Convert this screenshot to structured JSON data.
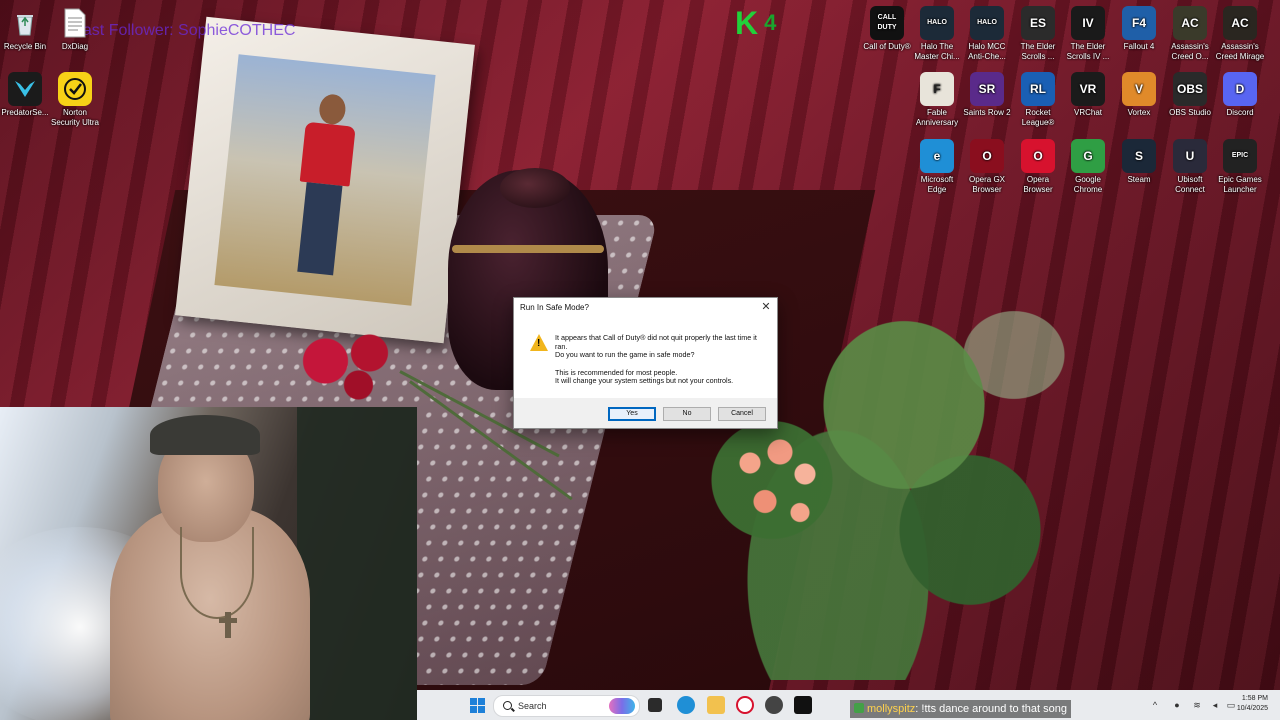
{
  "overlay": {
    "title_text": "Last Follower: SophieCOTHEC",
    "k_letter": "K",
    "k_count": "4"
  },
  "desktop_icons_left": [
    {
      "label": "Recycle Bin",
      "icon": "recycle-bin-icon"
    },
    {
      "label": "DxDiag",
      "icon": "dxdiag-icon"
    },
    {
      "label": "PredatorSe...",
      "icon": "predator-sense-icon"
    },
    {
      "label": "Norton Security Ultra",
      "icon": "norton-icon"
    }
  ],
  "desktop_icons_right": [
    {
      "label": "Call of Duty®",
      "icon": "call-of-duty-icon",
      "color": "#111111",
      "glyph": "CALL DUTY"
    },
    {
      "label": "Halo The Master Chi...",
      "icon": "halo-mcc-icon",
      "color": "#1c2a38",
      "glyph": "HALO"
    },
    {
      "label": "Halo MCC Anti-Che...",
      "icon": "halo-anticheat-icon",
      "color": "#1c2a38",
      "glyph": "HALO"
    },
    {
      "label": "The Elder Scrolls ...",
      "icon": "elder-scrolls-icon",
      "color": "#2b2b2b",
      "glyph": "ES"
    },
    {
      "label": "The Elder Scrolls IV ...",
      "icon": "oblivion-icon",
      "color": "#1a1a1a",
      "glyph": "IV"
    },
    {
      "label": "Fallout 4",
      "icon": "fallout4-icon",
      "color": "#1f5fa8",
      "glyph": "F4"
    },
    {
      "label": "Assassin's Creed O...",
      "icon": "ac-origins-icon",
      "color": "#3a3a2a",
      "glyph": "AC"
    },
    {
      "label": "Assassin's Creed Mirage",
      "icon": "ac-mirage-icon",
      "color": "#2a2620",
      "glyph": "AC"
    },
    {
      "label": "Fable Anniversary",
      "icon": "fable-icon",
      "color": "#e8e4da",
      "glyph": "F"
    },
    {
      "label": "Saints Row 2",
      "icon": "saints-row-icon",
      "color": "#5a2a8a",
      "glyph": "SR"
    },
    {
      "label": "Rocket League®",
      "icon": "rocket-league-icon",
      "color": "#1a5fb4",
      "glyph": "RL"
    },
    {
      "label": "VRChat",
      "icon": "vrchat-icon",
      "color": "#1b1b1b",
      "glyph": "VR"
    },
    {
      "label": "Vortex",
      "icon": "vortex-icon",
      "color": "#e08a2a",
      "glyph": "V"
    },
    {
      "label": "OBS Studio",
      "icon": "obs-icon",
      "color": "#2a2a2a",
      "glyph": "OBS"
    },
    {
      "label": "Discord",
      "icon": "discord-icon",
      "color": "#5865f2",
      "glyph": "D"
    },
    {
      "label": "Microsoft Edge",
      "icon": "edge-icon",
      "color": "#1f8fd6",
      "glyph": "e"
    },
    {
      "label": "Opera GX Browser",
      "icon": "opera-gx-icon",
      "color": "#8a0e1e",
      "glyph": "O"
    },
    {
      "label": "Opera Browser",
      "icon": "opera-icon",
      "color": "#d7122e",
      "glyph": "O"
    },
    {
      "label": "Google Chrome",
      "icon": "chrome-icon",
      "color": "#2f9e44",
      "glyph": "G"
    },
    {
      "label": "Steam",
      "icon": "steam-icon",
      "color": "#1b2838",
      "glyph": "S"
    },
    {
      "label": "Ubisoft Connect",
      "icon": "ubisoft-icon",
      "color": "#2a2a3a",
      "glyph": "U"
    },
    {
      "label": "Epic Games Launcher",
      "icon": "epic-games-icon",
      "color": "#222222",
      "glyph": "EPIC"
    }
  ],
  "dialog": {
    "title": "Run In Safe Mode?",
    "close_glyph": "✕",
    "message_line1": "It appears that Call of Duty® did not quit properly the last time it ran.",
    "message_line2": "Do you want to run the game in safe mode?",
    "message_line3": "This is recommended for most people.",
    "message_line4": "It will change your system settings but not your controls.",
    "buttons": {
      "yes": "Yes",
      "no": "No",
      "cancel": "Cancel"
    }
  },
  "taskbar": {
    "search_placeholder": "Search",
    "time": "1:58 PM",
    "date": "10/4/2025"
  },
  "chat": {
    "username": "mollyspitz",
    "message": ": !tts dance around to that song"
  },
  "colors": {
    "accent": "#0067c0",
    "warning": "#f1b51c"
  }
}
